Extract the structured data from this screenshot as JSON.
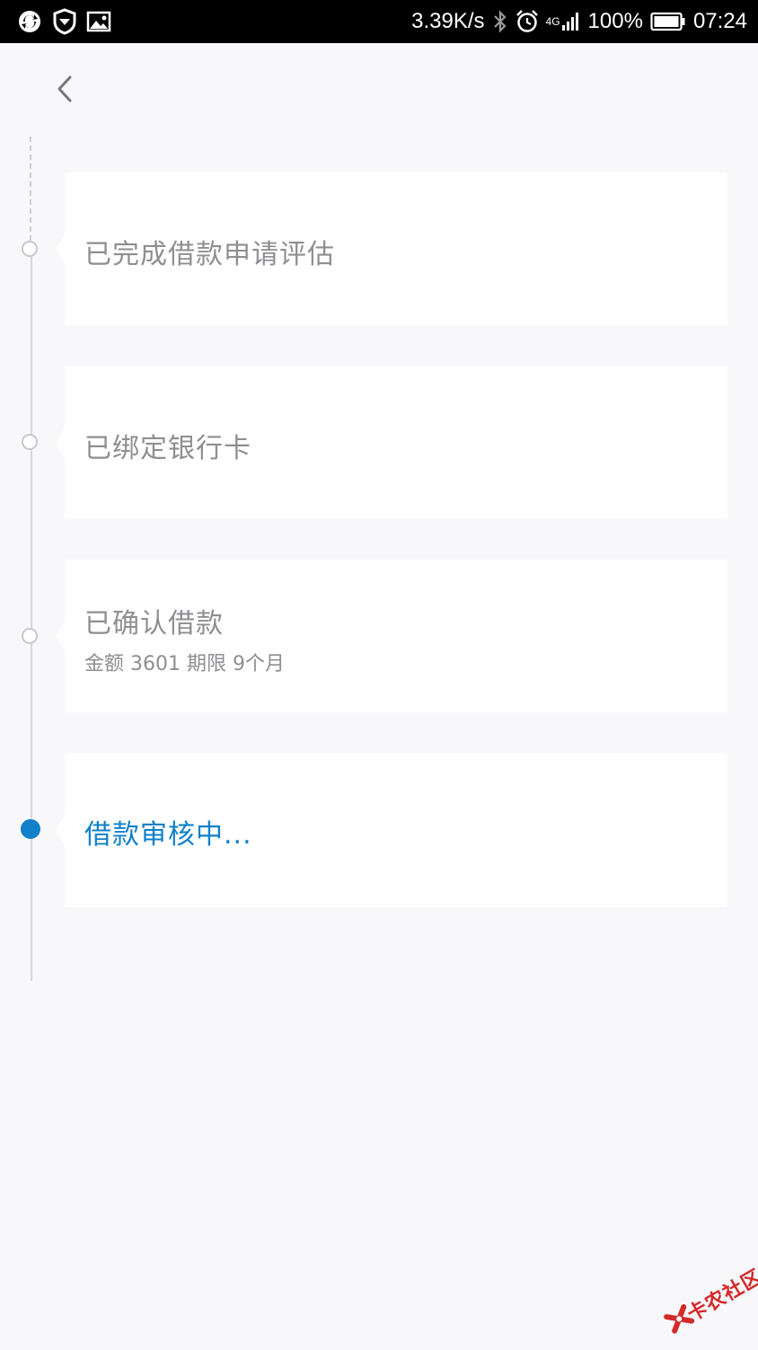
{
  "status_bar": {
    "network_speed": "3.39K/s",
    "network_type": "4G",
    "battery": "100%",
    "time": "07:24"
  },
  "steps": [
    {
      "title": "已完成借款申请评估",
      "state": "done"
    },
    {
      "title": "已绑定银行卡",
      "state": "done"
    },
    {
      "title": "已确认借款",
      "detail": "金额 3601 期限  9个月",
      "state": "done"
    },
    {
      "title": "借款审核中...",
      "state": "active"
    }
  ],
  "watermark": {
    "text": "卡农社区"
  },
  "colors": {
    "accent": "#1180c9",
    "inactive_text": "#8e8e93",
    "background": "#f8f8fa",
    "card": "#ffffff",
    "timeline": "#d7d7dc",
    "watermark": "#d42a2a"
  }
}
